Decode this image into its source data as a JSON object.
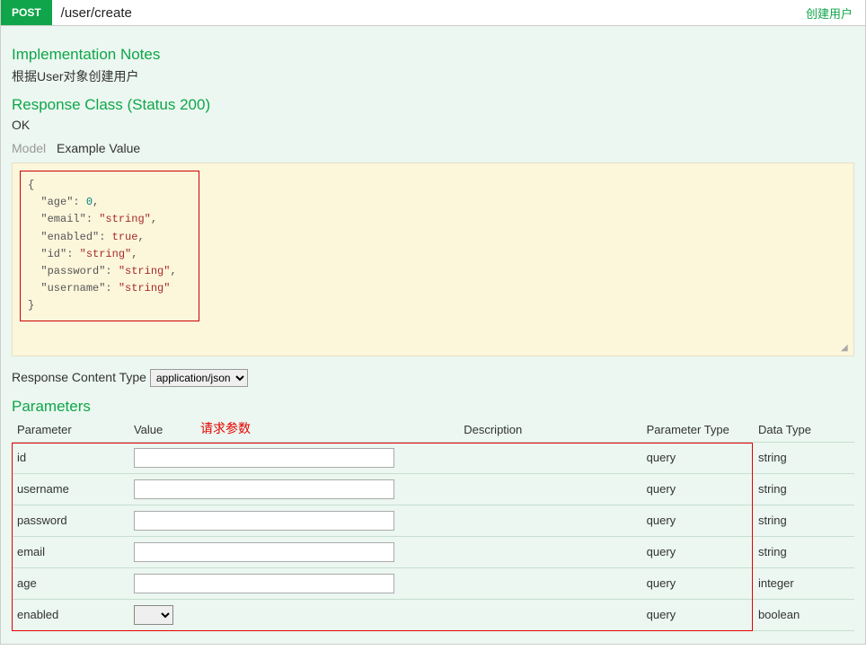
{
  "operation": {
    "method": "POST",
    "path": "/user/create",
    "summary": "创建用户"
  },
  "notes": {
    "heading": "Implementation Notes",
    "text": "根据User对象创建用户"
  },
  "response": {
    "heading": "Response Class (Status 200)",
    "status_text": "OK",
    "tabs": {
      "model": "Model",
      "example": "Example Value"
    },
    "example_pairs": [
      {
        "key": "age",
        "value": "0",
        "kind": "num"
      },
      {
        "key": "email",
        "value": "\"string\"",
        "kind": "str"
      },
      {
        "key": "enabled",
        "value": "true",
        "kind": "bool"
      },
      {
        "key": "id",
        "value": "\"string\"",
        "kind": "str"
      },
      {
        "key": "password",
        "value": "\"string\"",
        "kind": "str"
      },
      {
        "key": "username",
        "value": "\"string\"",
        "kind": "str"
      }
    ]
  },
  "content_type": {
    "label": "Response Content Type",
    "selected": "application/json"
  },
  "parameters": {
    "heading": "Parameters",
    "annotation": "请求参数",
    "columns": {
      "parameter": "Parameter",
      "value": "Value",
      "description": "Description",
      "param_type": "Parameter Type",
      "data_type": "Data Type"
    },
    "rows": [
      {
        "name": "id",
        "param_type": "query",
        "data_type": "string",
        "input": "text"
      },
      {
        "name": "username",
        "param_type": "query",
        "data_type": "string",
        "input": "text"
      },
      {
        "name": "password",
        "param_type": "query",
        "data_type": "string",
        "input": "text"
      },
      {
        "name": "email",
        "param_type": "query",
        "data_type": "string",
        "input": "text"
      },
      {
        "name": "age",
        "param_type": "query",
        "data_type": "integer",
        "input": "text"
      },
      {
        "name": "enabled",
        "param_type": "query",
        "data_type": "boolean",
        "input": "select"
      }
    ]
  }
}
